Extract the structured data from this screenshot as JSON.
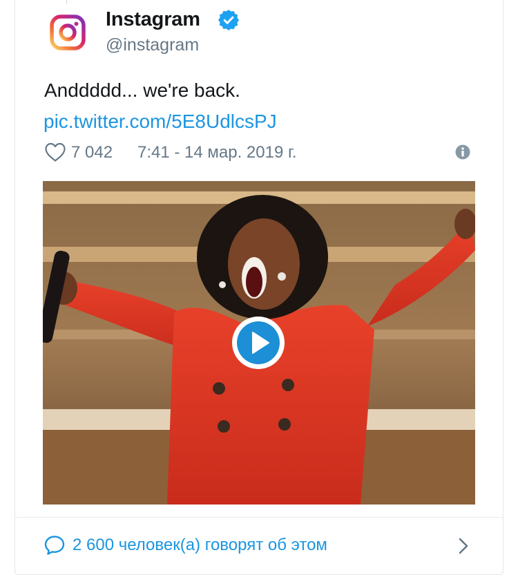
{
  "account": {
    "display_name": "Instagram",
    "handle": "@instagram",
    "verified": true,
    "avatar_icon": "instagram-logo-icon",
    "verified_icon": "verified-badge-icon"
  },
  "tweet": {
    "text": "Anddddd... we're back.",
    "link_text": "pic.twitter.com/5E8UdlcsPJ",
    "like_count": "7 042",
    "timestamp": "7:41 - 14 мар. 2019 г.",
    "like_icon": "heart-icon",
    "info_icon": "info-icon"
  },
  "media": {
    "type": "video",
    "play_icon": "play-icon"
  },
  "footer": {
    "conversation_text": "2 600 человек(а) говорят об этом",
    "comment_icon": "comment-bubble-icon",
    "chevron_icon": "chevron-right-icon"
  },
  "colors": {
    "link": "#1b95e0",
    "muted": "#657786",
    "text": "#14171a",
    "border": "#e1e8ed"
  }
}
